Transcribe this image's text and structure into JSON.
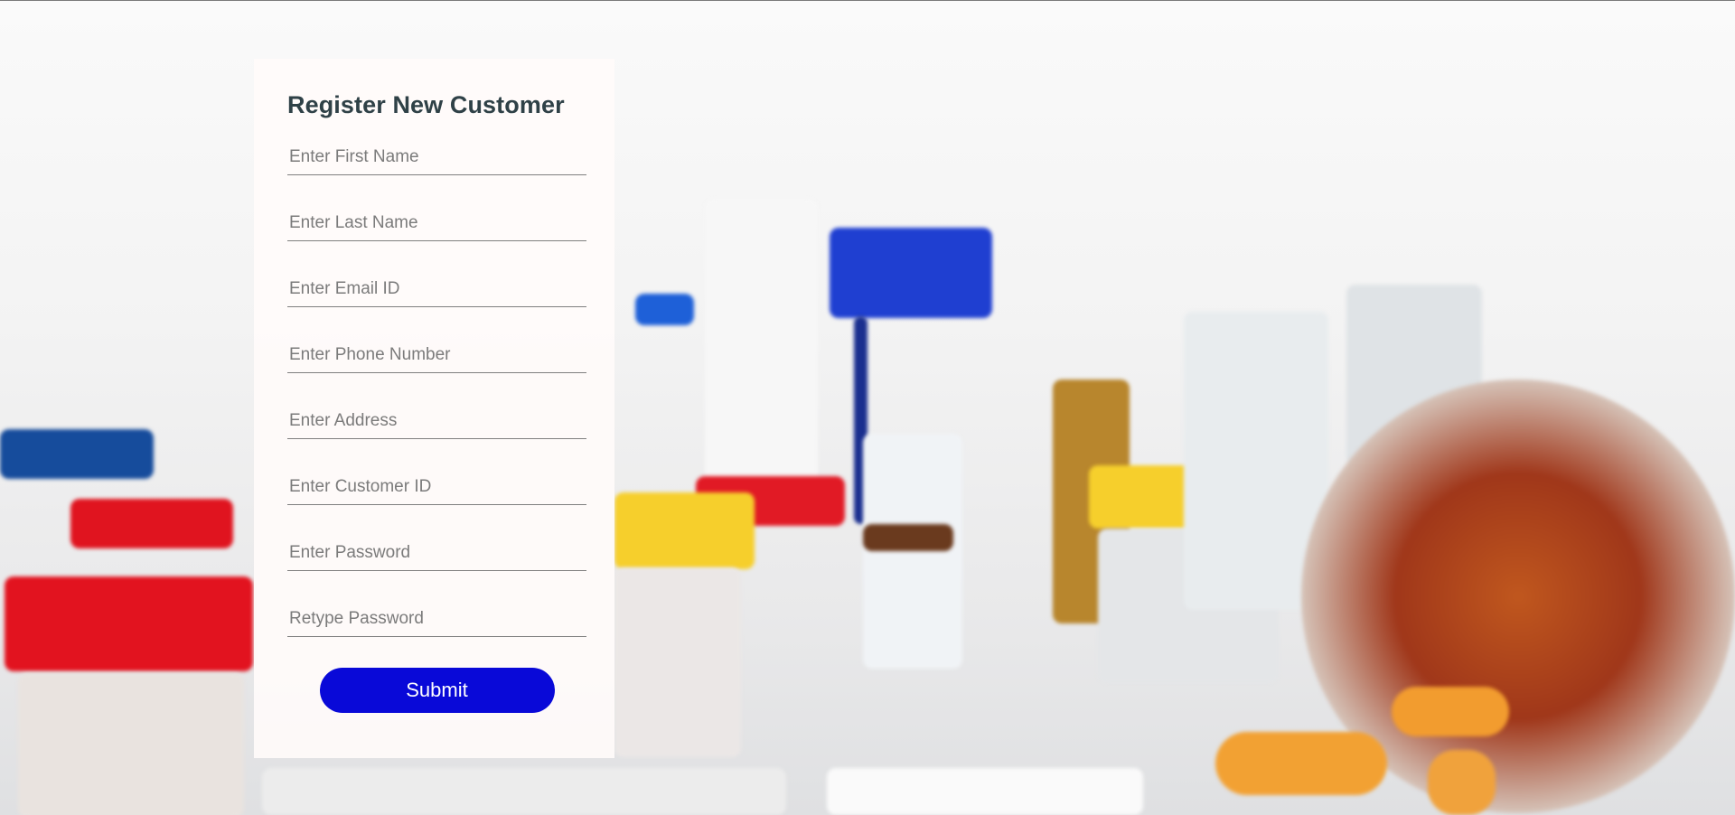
{
  "form": {
    "title": "Register New Customer",
    "fields": [
      {
        "placeholder": "Enter First Name",
        "value": ""
      },
      {
        "placeholder": "Enter Last Name",
        "value": ""
      },
      {
        "placeholder": "Enter Email ID",
        "value": ""
      },
      {
        "placeholder": "Enter Phone Number",
        "value": ""
      },
      {
        "placeholder": "Enter Address",
        "value": ""
      },
      {
        "placeholder": "Enter Customer ID",
        "value": ""
      },
      {
        "placeholder": "Enter Password",
        "value": ""
      },
      {
        "placeholder": "Retype Password",
        "value": ""
      }
    ],
    "submit_label": "Submit"
  },
  "colors": {
    "submit_button": "#0909d8",
    "title_text": "#2f4147",
    "card_background": "#fffbfa"
  }
}
